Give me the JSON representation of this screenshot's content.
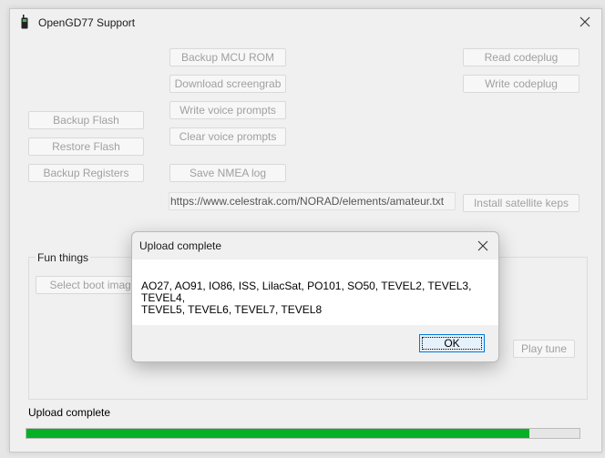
{
  "window": {
    "title": "OpenGD77 Support"
  },
  "buttons": {
    "backup_mcu_rom": "Backup MCU ROM",
    "download_screengrab": "Download screengrab",
    "write_voice_prompts": "Write voice prompts",
    "clear_voice_prompts": "Clear voice prompts",
    "save_nmea_log": "Save NMEA log",
    "read_codeplug": "Read codeplug",
    "write_codeplug": "Write codeplug",
    "backup_flash": "Backup Flash",
    "restore_flash": "Restore Flash",
    "backup_registers": "Backup Registers",
    "install_satellite_keps": "Install satellite keps",
    "select_boot_image": "Select boot image",
    "play_tune": "Play tune"
  },
  "satellite_url": "https://www.celestrak.com/NORAD/elements/amateur.txt",
  "fun_group": {
    "label": "Fun things"
  },
  "status": {
    "text": "Upload complete",
    "progress_fraction": 0.91
  },
  "dialog": {
    "title": "Upload complete",
    "message_line1": "AO27, AO91, IO86, ISS, LilacSat, PO101, SO50, TEVEL2, TEVEL3, TEVEL4,",
    "message_line2": "TEVEL5, TEVEL6, TEVEL7, TEVEL8",
    "ok_label": "OK"
  },
  "colors": {
    "progress_fill": "#06b025",
    "disabled_text": "#a0a0a0",
    "focus_border": "#0078d7"
  },
  "icons": {
    "app": "radio-icon",
    "close": "close-icon"
  }
}
